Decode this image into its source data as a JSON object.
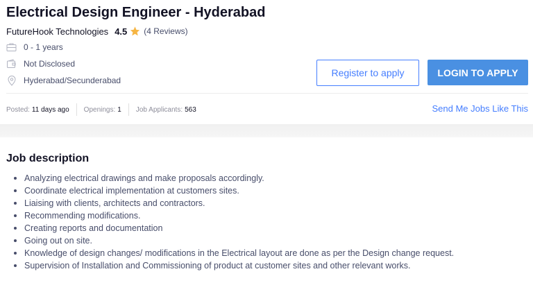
{
  "job": {
    "title": "Electrical Design Engineer - Hyderabad",
    "company": "FutureHook Technologies",
    "rating": "4.5",
    "reviews": "(4 Reviews)",
    "experience": "0 - 1 years",
    "salary": "Not Disclosed",
    "location": "Hyderabad/Secunderabad"
  },
  "actions": {
    "register_label": "Register to apply",
    "login_label": "LOGIN TO APPLY",
    "send_jobs_label": "Send Me Jobs Like This"
  },
  "stats": {
    "posted_label": "Posted:",
    "posted_value": "11 days ago",
    "openings_label": "Openings:",
    "openings_value": "1",
    "applicants_label": "Job Applicants:",
    "applicants_value": "563"
  },
  "description": {
    "heading": "Job description",
    "items": [
      "Analyzing electrical drawings and make proposals accordingly.",
      "Coordinate electrical implementation at customers sites.",
      "Liaising with clients, architects and contractors.",
      "Recommending modifications.",
      "Creating reports and documentation",
      "Going out on site.",
      "Knowledge of design changes/ modifications in the Electrical layout are done as per the Design change request.",
      "Supervision of Installation and Commissioning of product at customer sites and other relevant works."
    ]
  },
  "icons": {
    "star": "star-icon",
    "experience": "briefcase-icon",
    "salary": "wallet-icon",
    "location": "location-pin-icon"
  },
  "colors": {
    "accent": "#457eff",
    "login_button": "#4a90e2",
    "star": "#f6b543"
  }
}
